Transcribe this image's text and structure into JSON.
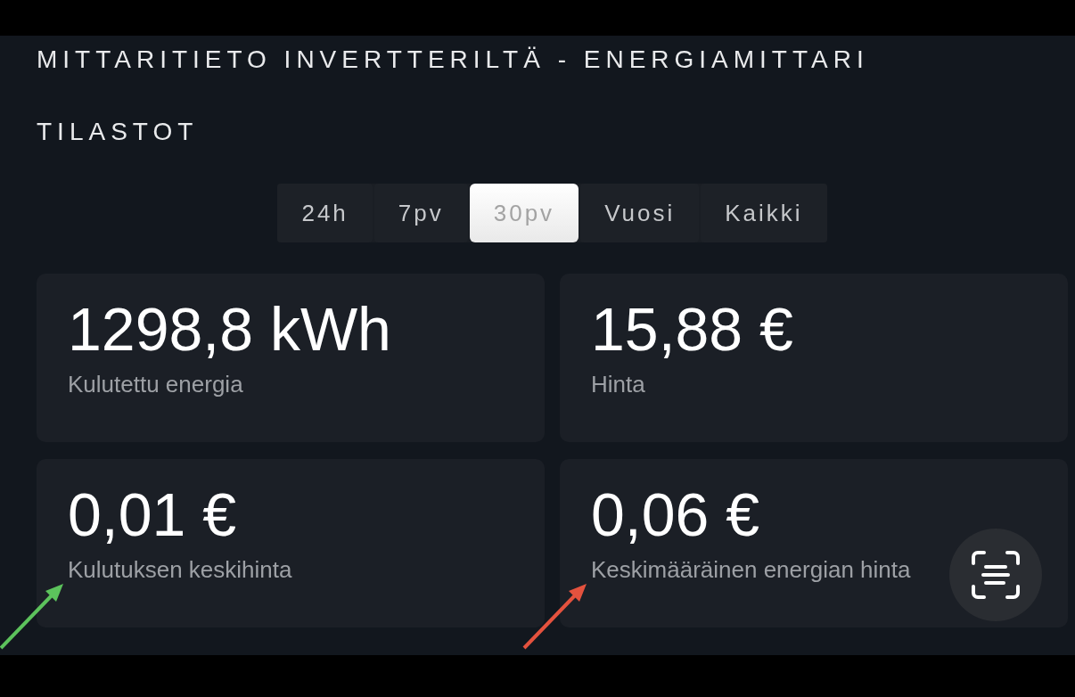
{
  "header": {
    "title": "MITTARITIETO INVERTTERILTÄ - ENERGIAMITTARI"
  },
  "section": {
    "title": "TILASTOT"
  },
  "period_tabs": [
    {
      "label": "24h",
      "selected": false
    },
    {
      "label": "7pv",
      "selected": false
    },
    {
      "label": "30pv",
      "selected": true
    },
    {
      "label": "Vuosi",
      "selected": false
    },
    {
      "label": "Kaikki",
      "selected": false
    }
  ],
  "stat_cards": [
    {
      "value": "1298,8 kWh",
      "label": "Kulutettu energia"
    },
    {
      "value": "15,88 €",
      "label": "Hinta"
    },
    {
      "value": "0,01 €",
      "label": "Kulutuksen keskihinta",
      "arrow": {
        "color": "#5cc25c"
      }
    },
    {
      "value": "0,06 €",
      "label": "Keskimääräinen energian hinta",
      "arrow": {
        "color": "#e4523e"
      }
    }
  ]
}
